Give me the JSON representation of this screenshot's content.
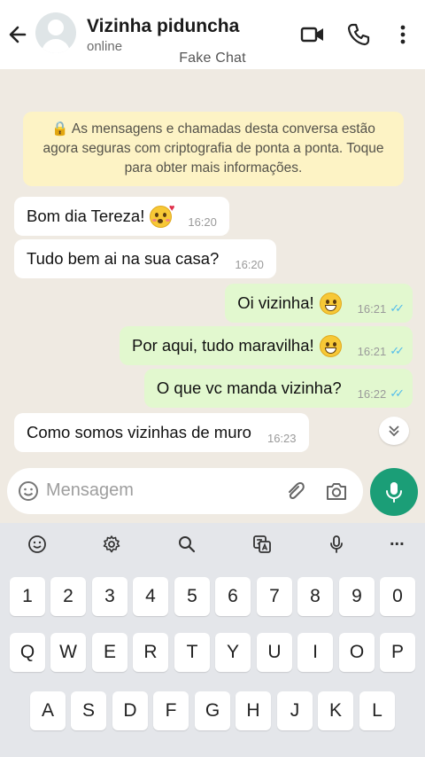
{
  "header": {
    "contact_name": "Vizinha piduncha",
    "status": "online",
    "icons": [
      "back-arrow-icon",
      "video-call-icon",
      "voice-call-icon",
      "more-options-icon"
    ]
  },
  "watermark": "Fake Chat",
  "encryption_notice": "🔒 As mensagens e chamadas desta conversa estão agora seguras com criptografia de ponta a ponta. Toque para obter mais informações.",
  "messages": [
    {
      "direction": "in",
      "text": "Bom dia Tereza!",
      "emoji": "face-blowing-kiss",
      "time": "16:20"
    },
    {
      "direction": "in",
      "text": "Tudo bem ai na sua casa?",
      "time": "16:20"
    },
    {
      "direction": "out",
      "text": "Oi vizinha!",
      "emoji": "grinning-face",
      "time": "16:21",
      "ticks": "✓✓"
    },
    {
      "direction": "out",
      "text": "Por aqui, tudo maravilha!",
      "emoji": "grinning-face",
      "time": "16:21",
      "ticks": "✓✓"
    },
    {
      "direction": "out",
      "text": "O que vc manda vizinha?",
      "time": "16:22",
      "ticks": "✓✓"
    },
    {
      "direction": "in",
      "text": "Como somos vizinhas de muro",
      "time": "16:23"
    }
  ],
  "input": {
    "placeholder": "Mensagem",
    "icons": [
      "emoji-icon",
      "attach-icon",
      "camera-icon",
      "mic-icon"
    ]
  },
  "colors": {
    "chat_bg": "#efeae2",
    "outgoing_bubble": "#e2f8cf",
    "incoming_bubble": "#ffffff",
    "encryption_bg": "#fdf3c5",
    "accent": "#1b9e77",
    "read_ticks": "#53bdeb"
  },
  "keyboard": {
    "toolbar": [
      "emoji-icon",
      "settings-icon",
      "search-icon",
      "translate-icon",
      "voice-input-icon"
    ],
    "toolbar_more": "...",
    "row_numbers": [
      "1",
      "2",
      "3",
      "4",
      "5",
      "6",
      "7",
      "8",
      "9",
      "0"
    ],
    "row_1": [
      "Q",
      "W",
      "E",
      "R",
      "T",
      "Y",
      "U",
      "I",
      "O",
      "P"
    ],
    "row_2": [
      "A",
      "S",
      "D",
      "F",
      "G",
      "H",
      "J",
      "K",
      "L"
    ]
  }
}
